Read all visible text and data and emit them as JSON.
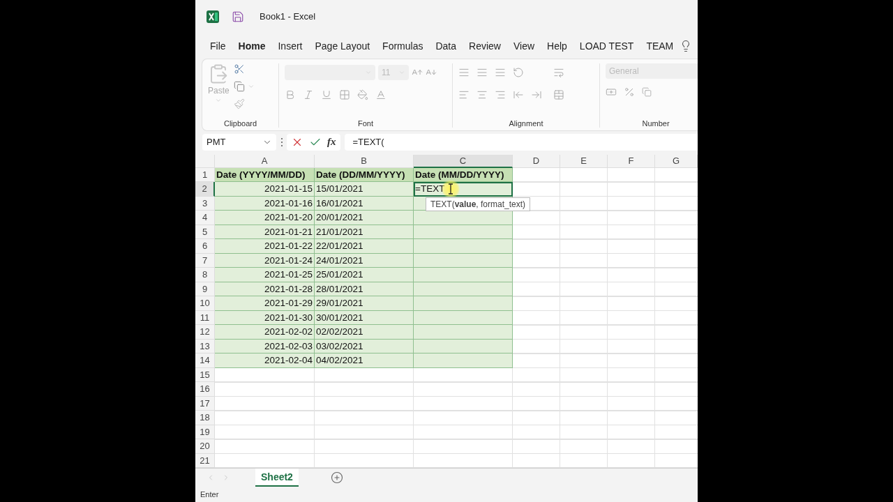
{
  "title_bar": {
    "title": "Book1  -  Excel"
  },
  "ribbon_tabs": [
    {
      "label": "File",
      "selected": false
    },
    {
      "label": "Home",
      "selected": true
    },
    {
      "label": "Insert",
      "selected": false
    },
    {
      "label": "Page Layout",
      "selected": false
    },
    {
      "label": "Formulas",
      "selected": false
    },
    {
      "label": "Data",
      "selected": false
    },
    {
      "label": "Review",
      "selected": false
    },
    {
      "label": "View",
      "selected": false
    },
    {
      "label": "Help",
      "selected": false
    },
    {
      "label": "LOAD TEST",
      "selected": false
    },
    {
      "label": "TEAM",
      "selected": false
    }
  ],
  "ribbon": {
    "paste_label": "Paste",
    "font_size": "11",
    "number_format": "General",
    "groups": [
      {
        "label": "Clipboard"
      },
      {
        "label": "Font"
      },
      {
        "label": "Alignment"
      },
      {
        "label": "Number"
      }
    ]
  },
  "formula_bar": {
    "name_box": "PMT",
    "fx": "fx",
    "formula": "=TEXT("
  },
  "sheet": {
    "columns": [
      {
        "label": "A",
        "selected": false
      },
      {
        "label": "B",
        "selected": false
      },
      {
        "label": "C",
        "selected": true
      },
      {
        "label": "D",
        "selected": false
      },
      {
        "label": "E",
        "selected": false
      },
      {
        "label": "F",
        "selected": false
      },
      {
        "label": "G",
        "selected": false
      }
    ],
    "rows": [
      {
        "number": "1",
        "kind": "header",
        "selected": false,
        "cells": [
          {
            "text": "Date (YYYY/MM/DD)",
            "active": false
          },
          {
            "text": "Date (DD/MM/YYYY)",
            "active": false
          },
          {
            "text": "Date (MM/DD/YYYY)",
            "active": false
          }
        ]
      },
      {
        "number": "2",
        "kind": "data",
        "selected": true,
        "cells": [
          {
            "text": "2021-01-15",
            "active": false
          },
          {
            "text": "15/01/2021",
            "active": false
          },
          {
            "text": "=TEXT",
            "active": true
          }
        ]
      },
      {
        "number": "3",
        "kind": "data",
        "selected": false,
        "cells": [
          {
            "text": "2021-01-16",
            "active": false
          },
          {
            "text": "16/01/2021",
            "active": false
          }
        ]
      },
      {
        "number": "4",
        "kind": "data",
        "selected": false,
        "cells": [
          {
            "text": "2021-01-20",
            "active": false
          },
          {
            "text": "20/01/2021",
            "active": false
          }
        ]
      },
      {
        "number": "5",
        "kind": "data",
        "selected": false,
        "cells": [
          {
            "text": "2021-01-21",
            "active": false
          },
          {
            "text": "21/01/2021",
            "active": false
          }
        ]
      },
      {
        "number": "6",
        "kind": "data",
        "selected": false,
        "cells": [
          {
            "text": "2021-01-22",
            "active": false
          },
          {
            "text": "22/01/2021",
            "active": false
          }
        ]
      },
      {
        "number": "7",
        "kind": "data",
        "selected": false,
        "cells": [
          {
            "text": "2021-01-24",
            "active": false
          },
          {
            "text": "24/01/2021",
            "active": false
          }
        ]
      },
      {
        "number": "8",
        "kind": "data",
        "selected": false,
        "cells": [
          {
            "text": "2021-01-25",
            "active": false
          },
          {
            "text": "25/01/2021",
            "active": false
          }
        ]
      },
      {
        "number": "9",
        "kind": "data",
        "selected": false,
        "cells": [
          {
            "text": "2021-01-28",
            "active": false
          },
          {
            "text": "28/01/2021",
            "active": false
          }
        ]
      },
      {
        "number": "10",
        "kind": "data",
        "selected": false,
        "cells": [
          {
            "text": "2021-01-29",
            "active": false
          },
          {
            "text": "29/01/2021",
            "active": false
          }
        ]
      },
      {
        "number": "11",
        "kind": "data",
        "selected": false,
        "cells": [
          {
            "text": "2021-01-30",
            "active": false
          },
          {
            "text": "30/01/2021",
            "active": false
          }
        ]
      },
      {
        "number": "12",
        "kind": "data",
        "selected": false,
        "cells": [
          {
            "text": "2021-02-02",
            "active": false
          },
          {
            "text": "02/02/2021",
            "active": false
          }
        ]
      },
      {
        "number": "13",
        "kind": "data",
        "selected": false,
        "cells": [
          {
            "text": "2021-02-03",
            "active": false
          },
          {
            "text": "03/02/2021",
            "active": false
          }
        ]
      },
      {
        "number": "14",
        "kind": "data",
        "selected": false,
        "cells": [
          {
            "text": "2021-02-04",
            "active": false
          },
          {
            "text": "04/02/2021",
            "active": false
          }
        ]
      },
      {
        "number": "15",
        "kind": "empty",
        "selected": false
      },
      {
        "number": "16",
        "kind": "empty",
        "selected": false
      },
      {
        "number": "17",
        "kind": "empty",
        "selected": false
      },
      {
        "number": "18",
        "kind": "empty",
        "selected": false
      },
      {
        "number": "19",
        "kind": "empty",
        "selected": false
      },
      {
        "number": "20",
        "kind": "empty",
        "selected": false
      },
      {
        "number": "21",
        "kind": "empty",
        "selected": false
      }
    ],
    "tooltip": "TEXT(**value**, format_text)"
  },
  "sheet_tabs": [
    {
      "label": "Sheet2",
      "selected": true
    }
  ],
  "status_bar": {
    "mode": "Enter"
  }
}
